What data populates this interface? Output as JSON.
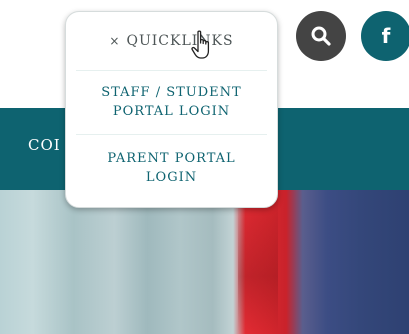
{
  "header": {
    "search_icon": "search-icon",
    "facebook_glyph": "f",
    "brand_color": "#0e6370"
  },
  "nav": {
    "visible_text": "COI"
  },
  "quicklinks": {
    "close_glyph": "×",
    "title": "QUICKLINKS",
    "links": [
      {
        "line1": "STAFF / STUDENT",
        "line2": "PORTAL LOGIN"
      },
      {
        "line1": "PARENT PORTAL",
        "line2": "LOGIN"
      }
    ]
  },
  "cursor_icon": "hand-pointer-icon"
}
